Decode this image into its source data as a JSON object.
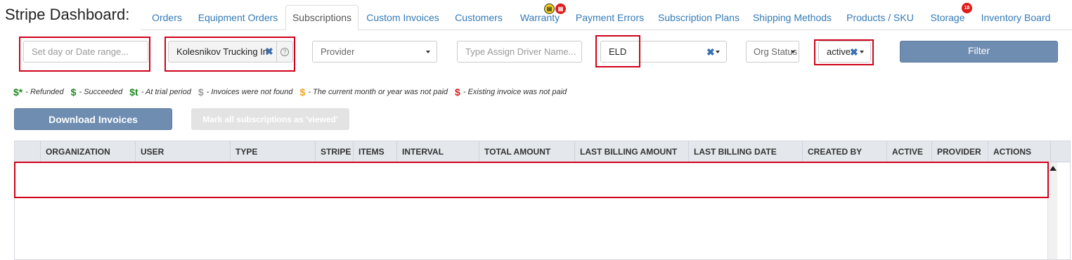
{
  "header": {
    "title": "Stripe Dashboard:"
  },
  "tabs": [
    {
      "label": "Orders"
    },
    {
      "label": "Equipment Orders"
    },
    {
      "label": "Subscriptions",
      "active": true
    },
    {
      "label": "Custom Invoices"
    },
    {
      "label": "Customers"
    },
    {
      "label": "Warranty"
    },
    {
      "label": "Payment Errors"
    },
    {
      "label": "Subscription Plans"
    },
    {
      "label": "Shipping Methods"
    },
    {
      "label": "Products / SKU"
    },
    {
      "label": "Storage"
    },
    {
      "label": "Inventory Board"
    }
  ],
  "badges": {
    "storage_count": "18"
  },
  "filters": {
    "date_placeholder": "Set day or Date range...",
    "organization_value": "Kolesnikov Trucking Inc",
    "provider_placeholder": "Provider",
    "driver_placeholder": "Type Assign Driver Name...",
    "type_value": "ELD",
    "org_status_placeholder": "Org Status",
    "active_value": "active",
    "filter_button": "Filter"
  },
  "legend": [
    {
      "symbol": "$*",
      "color": "#1e8a1e",
      "text": "- Refunded"
    },
    {
      "symbol": "$",
      "color": "#1e8a1e",
      "text": "- Succeeded"
    },
    {
      "symbol": "$t",
      "color": "#1e8a1e",
      "text": "- At trial period"
    },
    {
      "symbol": "$",
      "color": "#9a9a9a",
      "text": "- Invoices were not found"
    },
    {
      "symbol": "$",
      "color": "#f0a020",
      "text": "- The current month or year was not paid"
    },
    {
      "symbol": "$",
      "color": "#e01b1b",
      "text": "- Existing invoice was not paid"
    }
  ],
  "actions": {
    "download_invoices": "Download Invoices",
    "mark_viewed": "Mark all subscriptions as 'viewed'"
  },
  "table": {
    "columns": [
      "ORGANIZATION",
      "USER",
      "TYPE",
      "STRIPE",
      "ITEMS",
      "INTERVAL",
      "TOTAL AMOUNT",
      "LAST BILLING AMOUNT",
      "LAST BILLING DATE",
      "CREATED BY",
      "ACTIVE",
      "PROVIDER",
      "ACTIONS"
    ]
  },
  "colors": {
    "highlight": "#d0021b",
    "link": "#337ab7",
    "button": "#6e8db0"
  }
}
